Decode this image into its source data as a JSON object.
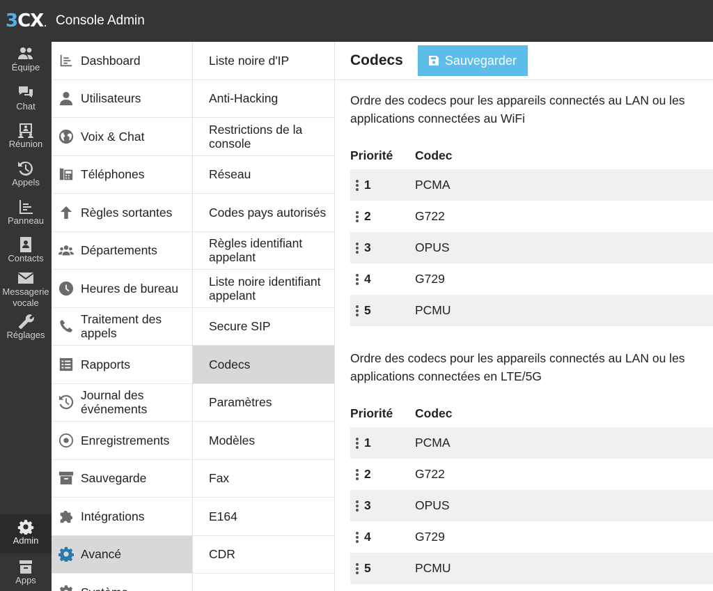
{
  "app": {
    "logo_3": "3",
    "logo_cx": "CX",
    "logo_dot": ".",
    "title": "Console Admin"
  },
  "rail": {
    "items": [
      {
        "label": "Équipe",
        "icon": "team-icon"
      },
      {
        "label": "Chat",
        "icon": "chat-icon"
      },
      {
        "label": "Réunion",
        "icon": "meeting-icon"
      },
      {
        "label": "Appels",
        "icon": "history-icon"
      },
      {
        "label": "Panneau",
        "icon": "panel-icon"
      },
      {
        "label": "Contacts",
        "icon": "contacts-icon"
      },
      {
        "label": "Messagerie vocale",
        "icon": "envelope-icon"
      },
      {
        "label": "Réglages",
        "icon": "wrench-icon"
      }
    ],
    "admin": {
      "label": "Admin",
      "icon": "gear-icon"
    },
    "apps": {
      "label": "Apps",
      "icon": "apps-icon"
    }
  },
  "menu1": {
    "items": [
      {
        "label": "Dashboard",
        "icon": "dashboard-icon"
      },
      {
        "label": "Utilisateurs",
        "icon": "user-icon"
      },
      {
        "label": "Voix & Chat",
        "icon": "globe-icon"
      },
      {
        "label": "Téléphones",
        "icon": "desk-phone-icon"
      },
      {
        "label": "Règles sortantes",
        "icon": "arrow-up-icon"
      },
      {
        "label": "Départements",
        "icon": "group-icon"
      },
      {
        "label": "Heures de bureau",
        "icon": "clock-icon"
      },
      {
        "label": "Traitement des appels",
        "icon": "phone-icon"
      },
      {
        "label": "Rapports",
        "icon": "report-icon"
      },
      {
        "label": "Journal des événements",
        "icon": "history-icon"
      },
      {
        "label": "Enregistrements",
        "icon": "record-icon"
      },
      {
        "label": "Sauvegarde",
        "icon": "archive-icon"
      },
      {
        "label": "Intégrations",
        "icon": "puzzle-icon"
      },
      {
        "label": "Avancé",
        "icon": "gear-icon",
        "active": true
      },
      {
        "label": "Système",
        "icon": "system-icon"
      }
    ]
  },
  "menu2": {
    "items": [
      {
        "label": "Liste noire d'IP"
      },
      {
        "label": "Anti-Hacking"
      },
      {
        "label": "Restrictions de la console"
      },
      {
        "label": "Réseau"
      },
      {
        "label": "Codes pays autorisés"
      },
      {
        "label": "Règles identifiant appelant"
      },
      {
        "label": "Liste noire identifiant appelant"
      },
      {
        "label": "Secure SIP"
      },
      {
        "label": "Codecs",
        "active": true
      },
      {
        "label": "Paramètres"
      },
      {
        "label": "Modèles"
      },
      {
        "label": "Fax"
      },
      {
        "label": "E164"
      },
      {
        "label": "CDR"
      },
      {
        "label": ""
      }
    ]
  },
  "main": {
    "title": "Codecs",
    "save_label": "Sauvegarder",
    "sections": [
      {
        "description": "Ordre des codecs pour les appareils connectés au LAN ou les applications connectées au WiFi",
        "col_priority": "Priorité",
        "col_codec": "Codec",
        "rows": [
          {
            "priority": "1",
            "codec": "PCMA"
          },
          {
            "priority": "2",
            "codec": "G722"
          },
          {
            "priority": "3",
            "codec": "OPUS"
          },
          {
            "priority": "4",
            "codec": "G729"
          },
          {
            "priority": "5",
            "codec": "PCMU"
          }
        ]
      },
      {
        "description": "Ordre des codecs pour les appareils connectés au LAN ou les applications connectées en LTE/5G",
        "col_priority": "Priorité",
        "col_codec": "Codec",
        "rows": [
          {
            "priority": "1",
            "codec": "PCMA"
          },
          {
            "priority": "2",
            "codec": "G722"
          },
          {
            "priority": "3",
            "codec": "OPUS"
          },
          {
            "priority": "4",
            "codec": "G729"
          },
          {
            "priority": "5",
            "codec": "PCMU"
          }
        ]
      }
    ]
  },
  "colors": {
    "accent": "#5bbde8",
    "dark": "#353535",
    "active_row": "#d8d8d8",
    "icon_active": "#2a7ab0"
  }
}
